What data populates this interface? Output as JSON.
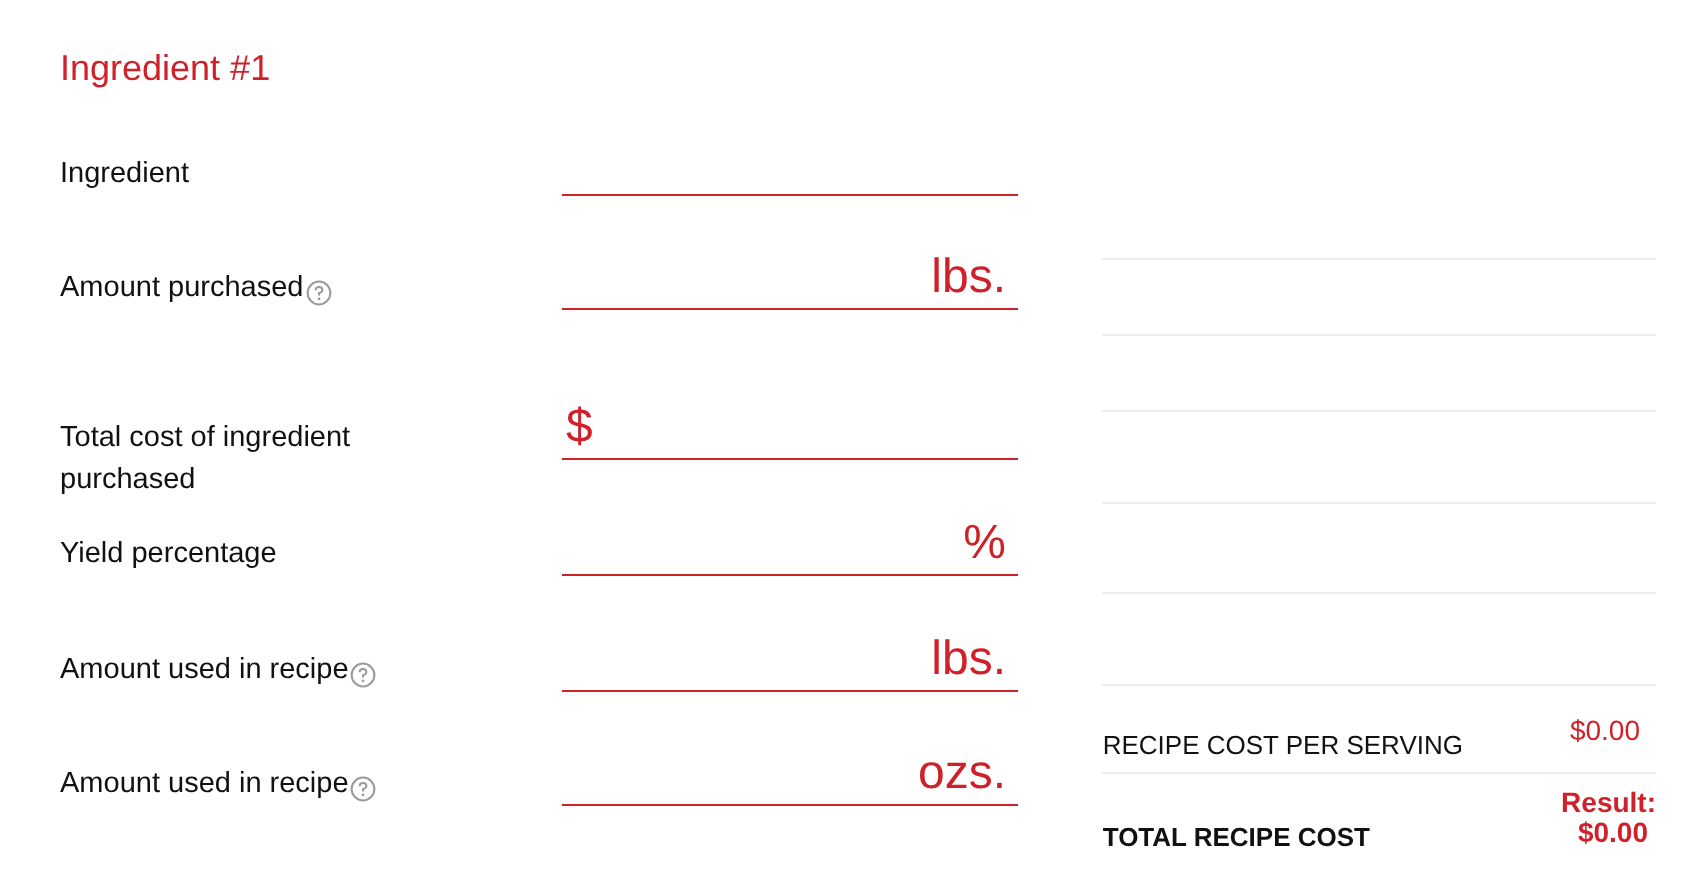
{
  "title": "Ingredient #1",
  "fields": [
    {
      "label": "Ingredient",
      "help": false
    },
    {
      "label": "Amount purchased",
      "help": true,
      "suffix": "lbs."
    },
    {
      "label": "Total cost of ingredient purchased",
      "help": false,
      "prefix": "$"
    },
    {
      "label": "Yield percentage",
      "help": false,
      "suffix": "%"
    },
    {
      "label": "Amount used in recipe",
      "help": true,
      "suffix": "lbs."
    },
    {
      "label": "Amount used in recipe",
      "help": true,
      "suffix": "ozs."
    }
  ],
  "summary": [
    {
      "kind": "plain",
      "label": "RECIPE COST PER SERVING",
      "value": "$0.00"
    },
    {
      "kind": "total",
      "label": "TOTAL RECIPE COST",
      "result_label": "Result:",
      "value": "$0.00"
    }
  ]
}
